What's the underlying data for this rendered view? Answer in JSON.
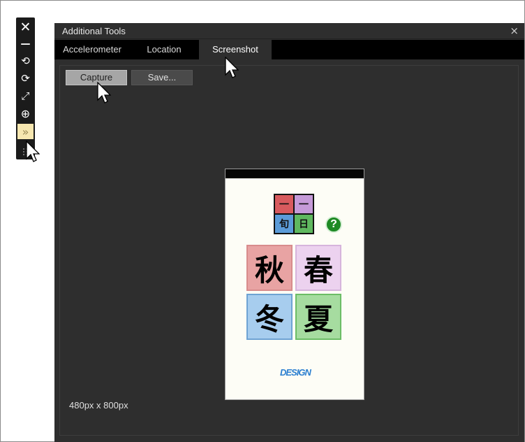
{
  "sidebar": {
    "tools": [
      {
        "icon": "close-icon",
        "glyph": "✕"
      },
      {
        "icon": "minimize-icon",
        "glyph": "—"
      },
      {
        "icon": "rotate-left-icon",
        "glyph": "⟲"
      },
      {
        "icon": "rotate-right-icon",
        "glyph": "⟳"
      },
      {
        "icon": "fit-screen-icon",
        "glyph": "⤢"
      },
      {
        "icon": "zoom-icon",
        "glyph": "⊕"
      },
      {
        "icon": "tools-icon",
        "glyph": "»"
      }
    ]
  },
  "window": {
    "title": "Additional Tools",
    "close_glyph": "×",
    "tabs": [
      {
        "label": "Accelerometer",
        "active": false
      },
      {
        "label": "Location",
        "active": false
      },
      {
        "label": "Screenshot",
        "active": true
      }
    ],
    "capture_label": "Capture",
    "save_label": "Save...",
    "size_label": "480px x 800px"
  },
  "phone_app": {
    "logo": [
      {
        "char": "一",
        "color": "#d85a5e"
      },
      {
        "char": "一",
        "color": "#c59ad8"
      },
      {
        "char": "旬",
        "color": "#5b9bd8"
      },
      {
        "char": "日",
        "color": "#5fb85f"
      }
    ],
    "help_glyph": "?",
    "seasons": [
      {
        "char": "秋",
        "name": "autumn",
        "color": "#e8a3a3",
        "border": "#d88c8c"
      },
      {
        "char": "春",
        "name": "spring",
        "color": "#ecd2ef",
        "border": "#d6b4dc"
      },
      {
        "char": "冬",
        "name": "winter",
        "color": "#a7cdee",
        "border": "#6ea3d3"
      },
      {
        "char": "夏",
        "name": "summer",
        "color": "#a6dca0",
        "border": "#6cbd66"
      }
    ],
    "design_mark": "DESIGN"
  }
}
